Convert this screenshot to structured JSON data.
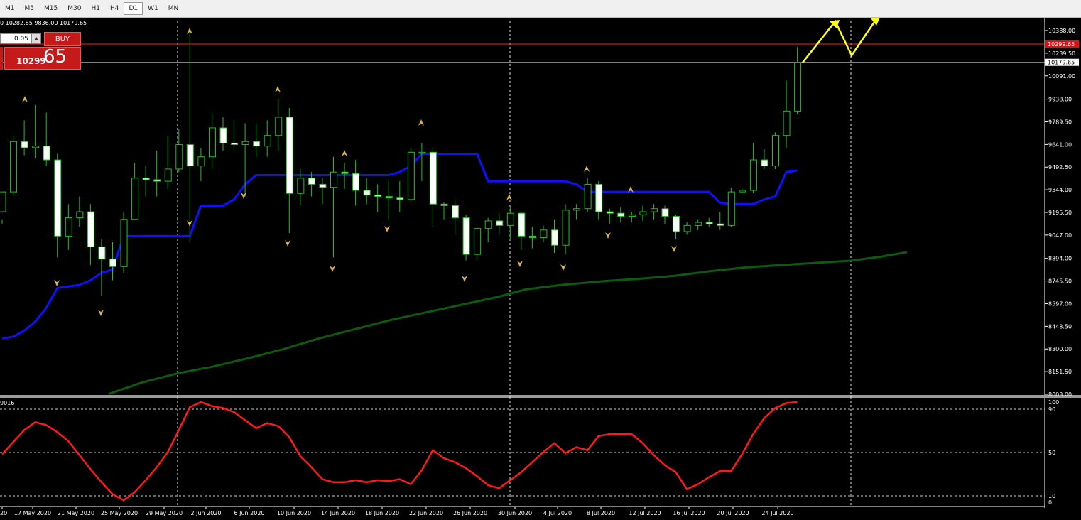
{
  "toolbar": {
    "timeframes": [
      "M1",
      "M5",
      "M15",
      "M30",
      "H1",
      "H4",
      "D1",
      "W1",
      "MN"
    ],
    "active": "D1"
  },
  "header": {
    "ohlc": "0 10282.65 9836.00 10179.65",
    "lot": "0.05",
    "buy_label": "BUY",
    "buy_price_small": "10299",
    "buy_price_big": "65"
  },
  "price_axis": {
    "ticks": [
      "10388.00",
      "10239.50",
      "10091.00",
      "9938.00",
      "9789.50",
      "9641.00",
      "9492.50",
      "9344.00",
      "9195.50",
      "9047.00",
      "8894.00",
      "8745.50",
      "8597.00",
      "8448.50",
      "8300.00",
      "8151.50",
      "8003.00"
    ],
    "ask_label": "10299.65",
    "bid_label": "10179.65"
  },
  "indicator": {
    "label": "9016",
    "levels": [
      "100",
      "90",
      "50",
      "10",
      "0"
    ]
  },
  "chart_data": {
    "type": "candlestick",
    "x_ticks": [
      "20",
      "17 May 2020",
      "21 May 2020",
      "25 May 2020",
      "29 May 2020",
      "2 Jun 2020",
      "6 Jun 2020",
      "10 Jun 2020",
      "14 Jun 2020",
      "18 Jun 2020",
      "22 Jun 2020",
      "26 Jun 2020",
      "30 Jun 2020",
      "4 Jul 2020",
      "8 Jul 2020",
      "12 Jul 2020",
      "16 Jul 2020",
      "20 Jul 2020",
      "24 Jul 2020"
    ],
    "ylim": [
      8003,
      10388
    ],
    "ask": 10299.65,
    "bid": 10179.65,
    "candles": [
      [
        9200,
        9330,
        9150,
        9120
      ],
      [
        9330,
        9660,
        9300,
        9700
      ],
      [
        9660,
        9620,
        9570,
        9800
      ],
      [
        9620,
        9630,
        9550,
        9900
      ],
      [
        9630,
        9540,
        9500,
        9850
      ],
      [
        9540,
        9040,
        8900,
        9580
      ],
      [
        9040,
        9160,
        8950,
        9250
      ],
      [
        9160,
        9200,
        9100,
        9300
      ],
      [
        9200,
        8970,
        8850,
        9250
      ],
      [
        8970,
        8890,
        8650,
        9020
      ],
      [
        8890,
        8840,
        8750,
        9000
      ],
      [
        8840,
        9150,
        8800,
        9200
      ],
      [
        9150,
        9420,
        9150,
        9520
      ],
      [
        9420,
        9410,
        9300,
        9500
      ],
      [
        9410,
        9400,
        9300,
        9600
      ],
      [
        9400,
        9480,
        9350,
        9700
      ],
      [
        9480,
        9640,
        9460,
        9740
      ],
      [
        9640,
        9500,
        9000,
        10380
      ],
      [
        9500,
        9560,
        9400,
        9620
      ],
      [
        9560,
        9750,
        9480,
        9850
      ],
      [
        9750,
        9650,
        9600,
        9820
      ],
      [
        9650,
        9640,
        9600,
        9800
      ],
      [
        9640,
        9660,
        9300,
        9780
      ],
      [
        9660,
        9630,
        9560,
        9780
      ],
      [
        9630,
        9700,
        9560,
        9800
      ],
      [
        9700,
        9820,
        9600,
        9940
      ],
      [
        9820,
        9320,
        9060,
        9880
      ],
      [
        9320,
        9420,
        9240,
        9480
      ],
      [
        9420,
        9380,
        9300,
        9460
      ],
      [
        9380,
        9360,
        9250,
        9420
      ],
      [
        9360,
        9460,
        8900,
        9560
      ],
      [
        9460,
        9450,
        9350,
        9520
      ],
      [
        9450,
        9340,
        9240,
        9540
      ],
      [
        9340,
        9310,
        9250,
        9420
      ],
      [
        9310,
        9300,
        9200,
        9380
      ],
      [
        9300,
        9290,
        9150,
        9400
      ],
      [
        9290,
        9280,
        9200,
        9400
      ],
      [
        9280,
        9590,
        9260,
        9620
      ],
      [
        9590,
        9590,
        9400,
        9650
      ],
      [
        9590,
        9250,
        9100,
        9620
      ],
      [
        9250,
        9240,
        9150,
        9260
      ],
      [
        9240,
        9160,
        9050,
        9280
      ],
      [
        9160,
        8920,
        8880,
        9180
      ],
      [
        8920,
        9090,
        8880,
        9100
      ],
      [
        9090,
        9140,
        9000,
        9160
      ],
      [
        9140,
        9110,
        9050,
        9190
      ],
      [
        9110,
        9190,
        9010,
        9230
      ],
      [
        9190,
        9040,
        8950,
        9200
      ],
      [
        9040,
        9030,
        8960,
        9100
      ],
      [
        9030,
        9080,
        9000,
        9110
      ],
      [
        9080,
        8980,
        8930,
        9150
      ],
      [
        8980,
        9210,
        8920,
        9250
      ],
      [
        9210,
        9220,
        9150,
        9250
      ],
      [
        9220,
        9380,
        9200,
        9420
      ],
      [
        9380,
        9200,
        9150,
        9400
      ],
      [
        9200,
        9190,
        9120,
        9220
      ],
      [
        9190,
        9170,
        9130,
        9230
      ],
      [
        9170,
        9180,
        9130,
        9200
      ],
      [
        9180,
        9200,
        9140,
        9240
      ],
      [
        9200,
        9220,
        9150,
        9250
      ],
      [
        9220,
        9170,
        9120,
        9240
      ],
      [
        9170,
        9070,
        9020,
        9180
      ],
      [
        9070,
        9110,
        9050,
        9130
      ],
      [
        9110,
        9130,
        9080,
        9150
      ],
      [
        9130,
        9120,
        9100,
        9160
      ],
      [
        9120,
        9110,
        9080,
        9200
      ],
      [
        9110,
        9330,
        9100,
        9360
      ],
      [
        9330,
        9340,
        9320,
        9350
      ],
      [
        9340,
        9540,
        9320,
        9650
      ],
      [
        9540,
        9500,
        9480,
        9610
      ],
      [
        9500,
        9700,
        9480,
        9720
      ],
      [
        9700,
        9860,
        9620,
        10060
      ],
      [
        9860,
        10180,
        9840,
        10280
      ]
    ],
    "supertrend": [
      8370,
      8380,
      8420,
      8480,
      8570,
      8700,
      8710,
      8720,
      8750,
      8800,
      8820,
      9040,
      9040,
      9040,
      9040,
      9040,
      9040,
      9040,
      9240,
      9240,
      9240,
      9280,
      9380,
      9440,
      9440,
      9440,
      9440,
      9440,
      9440,
      9440,
      9440,
      9440,
      9440,
      9440,
      9440,
      9440,
      9460,
      9500,
      9580,
      9580,
      9580,
      9580,
      9580,
      9580,
      9400,
      9400,
      9400,
      9400,
      9400,
      9400,
      9400,
      9400,
      9380,
      9330,
      9330,
      9330,
      9330,
      9330,
      9330,
      9330,
      9330,
      9330,
      9330,
      9330,
      9330,
      9260,
      9250,
      9250,
      9250,
      9280,
      9300,
      9460,
      9470
    ],
    "ma": [
      [
        153,
        8005
      ],
      [
        200,
        8080
      ],
      [
        250,
        8140
      ],
      [
        300,
        8185
      ],
      [
        350,
        8240
      ],
      [
        400,
        8300
      ],
      [
        450,
        8370
      ],
      [
        500,
        8430
      ],
      [
        550,
        8490
      ],
      [
        600,
        8540
      ],
      [
        650,
        8590
      ],
      [
        700,
        8640
      ],
      [
        740,
        8690
      ],
      [
        790,
        8720
      ],
      [
        850,
        8745
      ],
      [
        900,
        8760
      ],
      [
        950,
        8780
      ],
      [
        1000,
        8810
      ],
      [
        1050,
        8835
      ],
      [
        1100,
        8850
      ],
      [
        1150,
        8865
      ],
      [
        1200,
        8880
      ],
      [
        1240,
        8905
      ],
      [
        1277,
        8935
      ]
    ],
    "oscillator": [
      48,
      60,
      72,
      80,
      77,
      70,
      61,
      47,
      33,
      20,
      8,
      2,
      10,
      22,
      35,
      50,
      72,
      95,
      100,
      96,
      94,
      90,
      82,
      74,
      79,
      76,
      65,
      46,
      35,
      23,
      20,
      20,
      22,
      20,
      22,
      21,
      23,
      18,
      32,
      52,
      44,
      40,
      34,
      26,
      17,
      14,
      22,
      30,
      40,
      50,
      59,
      49,
      55,
      52,
      66,
      68,
      68,
      68,
      59,
      47,
      37,
      30,
      13,
      18,
      25,
      31,
      31,
      48,
      68,
      84,
      94,
      99,
      100
    ]
  }
}
